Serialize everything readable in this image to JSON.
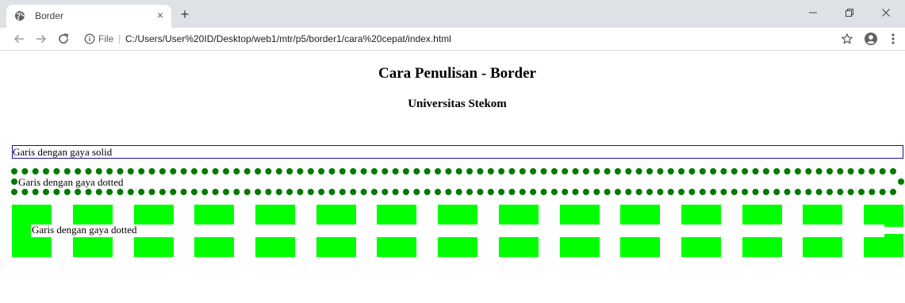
{
  "browser": {
    "tab": {
      "title": "Border",
      "favicon": "globe-icon"
    },
    "new_tab_icon": "plus-icon",
    "window_controls": [
      "minimize-icon",
      "restore-icon",
      "close-icon"
    ],
    "toolbar": {
      "back_icon": "back-arrow-icon",
      "forward_icon": "forward-arrow-icon",
      "reload_icon": "reload-icon",
      "scheme_label": "File",
      "url": "C:/Users/User%20ID/Desktop/web1/mtr/p5/border1/cara%20cepat/index.html",
      "bookmark_icon": "star-icon",
      "profile_icon": "account-icon",
      "menu_icon": "more-vert-icon"
    }
  },
  "page": {
    "heading": "Cara Penulisan - Border",
    "subheading": "Universitas Stekom",
    "boxes": [
      {
        "text": "Garis dengan gaya solid",
        "border_style": "solid",
        "border_color": "#1a0ea8"
      },
      {
        "text": "Garis dengan gaya dotted",
        "border_style": "dotted",
        "border_color": "#007a00"
      },
      {
        "text": "Garis dengan gaya dotted",
        "border_style": "dashed",
        "border_color": "#00ff00"
      }
    ]
  },
  "colors": {
    "tabstrip": "#dee1e6",
    "dotted_border": "#007a00",
    "dashed_border": "#00ff00",
    "solid_border": "#1a0ea8"
  }
}
